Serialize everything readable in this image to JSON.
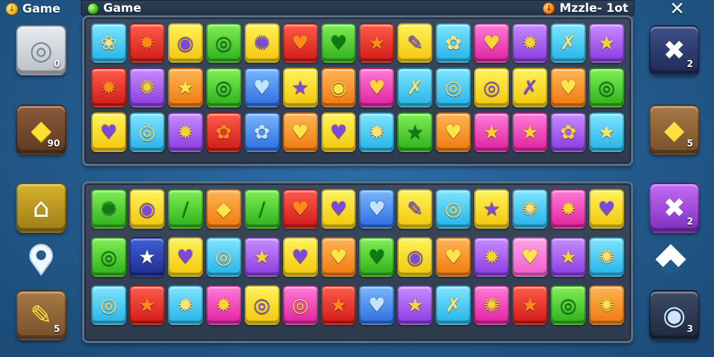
{
  "header": {
    "left_label": "Game",
    "left_coin_symbol": "↓",
    "bar_title": "Game",
    "bar_right_label": "Mzzle- 1ot",
    "bar_right_coin_symbol": "↓",
    "close_symbol": "✕"
  },
  "left_buttons": [
    {
      "name": "bomb-button",
      "icon": "ring-icon",
      "glyph": "◎",
      "count": "0",
      "color": "#c7ced5"
    },
    {
      "name": "diamond-button",
      "icon": "diamond-icon",
      "glyph": "◆",
      "count": "90",
      "color": "#6e452b"
    },
    {
      "name": "home-button",
      "icon": "home-icon",
      "glyph": "⌂",
      "count": "",
      "color": "#b8951c"
    },
    {
      "name": "pencil-button",
      "icon": "pencil-icon",
      "glyph": "✎",
      "count": "5",
      "color": "#8a5a2e"
    }
  ],
  "right_buttons": [
    {
      "name": "hammer-button",
      "icon": "crossed-tools-icon",
      "glyph": "✖",
      "count": "2",
      "color": "#2b3b72"
    },
    {
      "name": "gem-button",
      "icon": "diamond-icon",
      "glyph": "◆",
      "count": "5",
      "color": "#8a6035"
    },
    {
      "name": "swap-button",
      "icon": "crossed-tools-icon",
      "glyph": "✖",
      "count": "2",
      "color": "#9a46d8"
    },
    {
      "name": "ring-button",
      "icon": "ring-icon",
      "glyph": "◉",
      "count": "3",
      "color": "#2a3653"
    }
  ],
  "board_top": [
    [
      [
        "cyan",
        "❀"
      ],
      [
        "red",
        "✹"
      ],
      [
        "yellow",
        "◉"
      ],
      [
        "green",
        "◎"
      ],
      [
        "yellow",
        "✺"
      ],
      [
        "red",
        "♥"
      ],
      [
        "green",
        "♥"
      ],
      [
        "red",
        "★"
      ],
      [
        "yellow",
        "✎"
      ],
      [
        "cyan",
        "✿"
      ],
      [
        "magenta",
        "♥"
      ],
      [
        "purple",
        "✹"
      ],
      [
        "cyan",
        "✗"
      ],
      [
        "purple",
        "★"
      ]
    ],
    [
      [
        "red",
        "✹"
      ],
      [
        "purple",
        "✺"
      ],
      [
        "orange",
        "★"
      ],
      [
        "green",
        "◎"
      ],
      [
        "blue",
        "♥"
      ],
      [
        "yellow",
        "★"
      ],
      [
        "orange",
        "◉"
      ],
      [
        "magenta",
        "♥"
      ],
      [
        "cyan",
        "✗"
      ],
      [
        "cyan",
        "◎"
      ],
      [
        "yellow",
        "◎"
      ],
      [
        "yellow",
        "✗"
      ],
      [
        "orange",
        "♥"
      ],
      [
        "green",
        "◎"
      ]
    ],
    [
      [
        "yellow",
        "♥"
      ],
      [
        "cyan",
        "◎"
      ],
      [
        "purple",
        "✹"
      ],
      [
        "red",
        "✿"
      ],
      [
        "blue",
        "✿"
      ],
      [
        "orange",
        "♥"
      ],
      [
        "yellow",
        "♥"
      ],
      [
        "cyan",
        "✹"
      ],
      [
        "green",
        "★"
      ],
      [
        "orange",
        "♥"
      ],
      [
        "magenta",
        "★"
      ],
      [
        "magenta",
        "★"
      ],
      [
        "purple",
        "✿"
      ],
      [
        "cyan",
        "★"
      ]
    ]
  ],
  "board_bottom": [
    [
      [
        "green",
        "✺"
      ],
      [
        "yellow",
        "◉"
      ],
      [
        "green",
        "/"
      ],
      [
        "orange",
        "◆"
      ],
      [
        "green",
        "/"
      ],
      [
        "red",
        "♥"
      ],
      [
        "yellow",
        "♥"
      ],
      [
        "blue",
        "♥"
      ],
      [
        "yellow",
        "✎"
      ],
      [
        "cyan",
        "◎"
      ],
      [
        "yellow",
        "★"
      ],
      [
        "cyan",
        "✺"
      ],
      [
        "magenta",
        "✹"
      ],
      [
        "yellow",
        "♥"
      ]
    ],
    [
      [
        "green",
        "◎"
      ],
      [
        "navy",
        "★"
      ],
      [
        "yellow",
        "♥"
      ],
      [
        "cyan",
        "◎"
      ],
      [
        "purple",
        "★"
      ],
      [
        "yellow",
        "♥"
      ],
      [
        "orange",
        "♥"
      ],
      [
        "green",
        "♥"
      ],
      [
        "yellow",
        "◉"
      ],
      [
        "orange",
        "♥"
      ],
      [
        "purple",
        "✹"
      ],
      [
        "pink",
        "♥"
      ],
      [
        "purple",
        "★"
      ],
      [
        "cyan",
        "✺"
      ]
    ],
    [
      [
        "cyan",
        "◎"
      ],
      [
        "red",
        "★"
      ],
      [
        "cyan",
        "✹"
      ],
      [
        "magenta",
        "✹"
      ],
      [
        "yellow",
        "◎"
      ],
      [
        "magenta",
        "◎"
      ],
      [
        "red",
        "★"
      ],
      [
        "blue",
        "♥"
      ],
      [
        "purple",
        "★"
      ],
      [
        "cyan",
        "✗"
      ],
      [
        "magenta",
        "✺"
      ],
      [
        "red",
        "★"
      ],
      [
        "green",
        "◎"
      ],
      [
        "orange",
        "✺"
      ]
    ]
  ]
}
